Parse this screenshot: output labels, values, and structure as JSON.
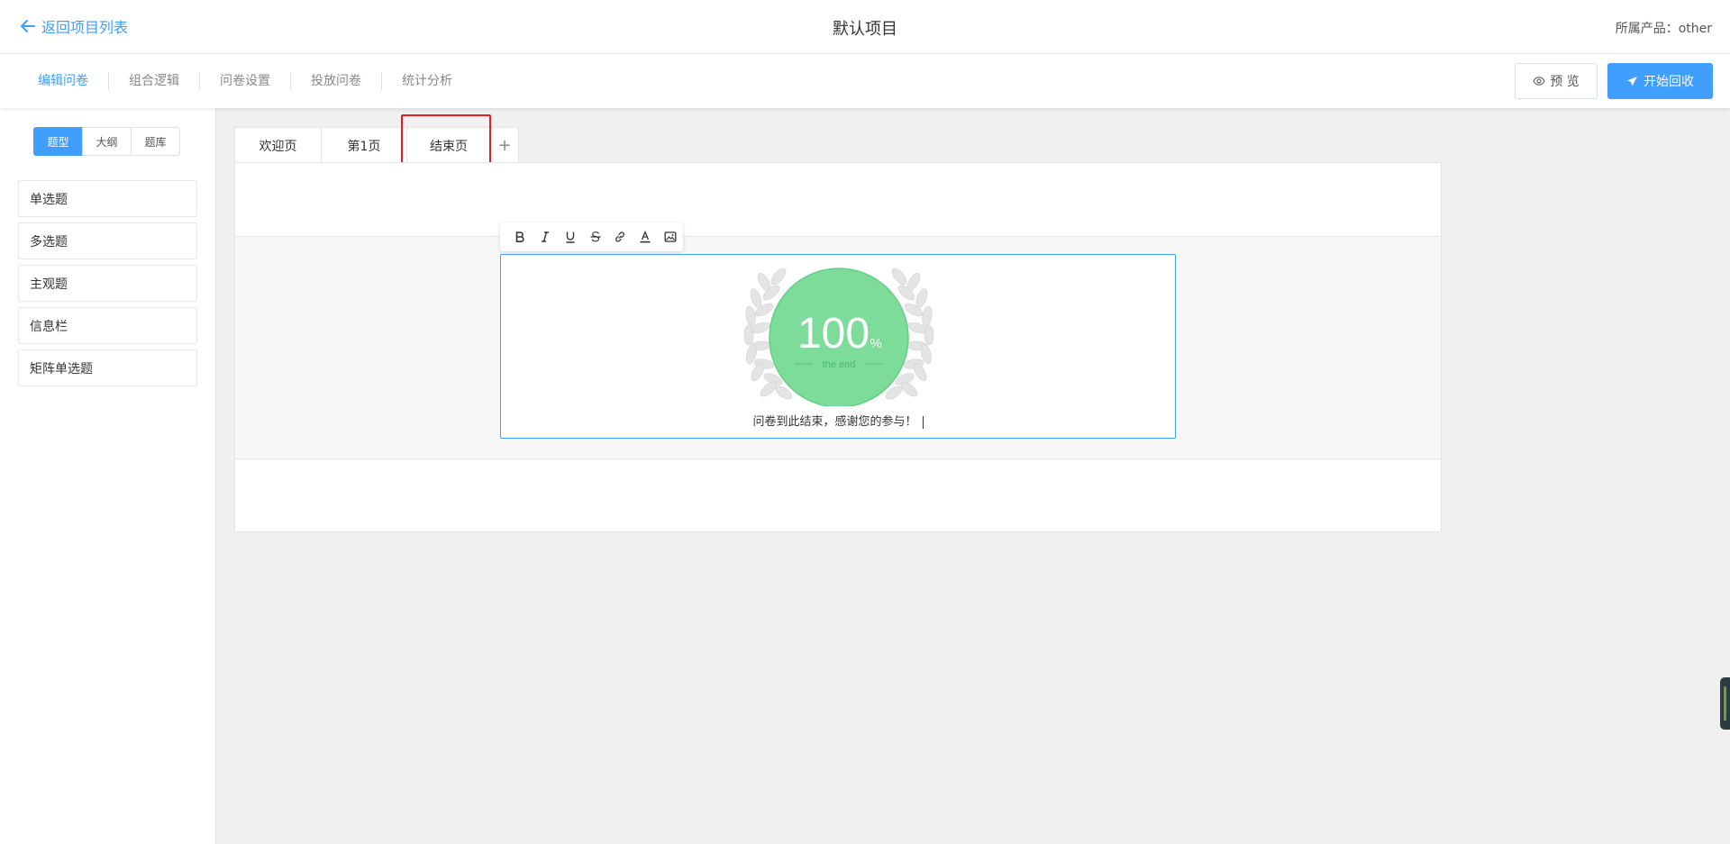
{
  "header": {
    "back_label": "返回项目列表",
    "project_title": "默认项目",
    "product_label": "所属产品：other"
  },
  "toolbar": {
    "nav": [
      {
        "label": "编辑问卷",
        "active": true
      },
      {
        "label": "组合逻辑",
        "active": false
      },
      {
        "label": "问卷设置",
        "active": false
      },
      {
        "label": "投放问卷",
        "active": false
      },
      {
        "label": "统计分析",
        "active": false
      }
    ],
    "preview_label": "预 览",
    "start_label": "开始回收"
  },
  "sidebar": {
    "segments": [
      {
        "label": "题型",
        "active": true
      },
      {
        "label": "大纲",
        "active": false
      },
      {
        "label": "题库",
        "active": false
      }
    ],
    "question_types": [
      "单选题",
      "多选题",
      "主观题",
      "信息栏",
      "矩阵单选题"
    ]
  },
  "tabs": [
    {
      "label": "欢迎页"
    },
    {
      "label": "第1页"
    },
    {
      "label": "结束页",
      "selected": true
    },
    {
      "label": "+"
    }
  ],
  "editor": {
    "toolbar_icons": [
      "bold-icon",
      "italic-icon",
      "underline-icon",
      "strikethrough-icon",
      "link-icon",
      "font-color-icon",
      "image-icon"
    ],
    "badge_number": "100",
    "badge_percent": "%",
    "badge_caption": "the end",
    "end_message": "问卷到此结束，感谢您的参与！"
  },
  "colors": {
    "accent": "#409eff",
    "badge_green": "#7ddc9a",
    "highlight_red": "#e02020"
  }
}
